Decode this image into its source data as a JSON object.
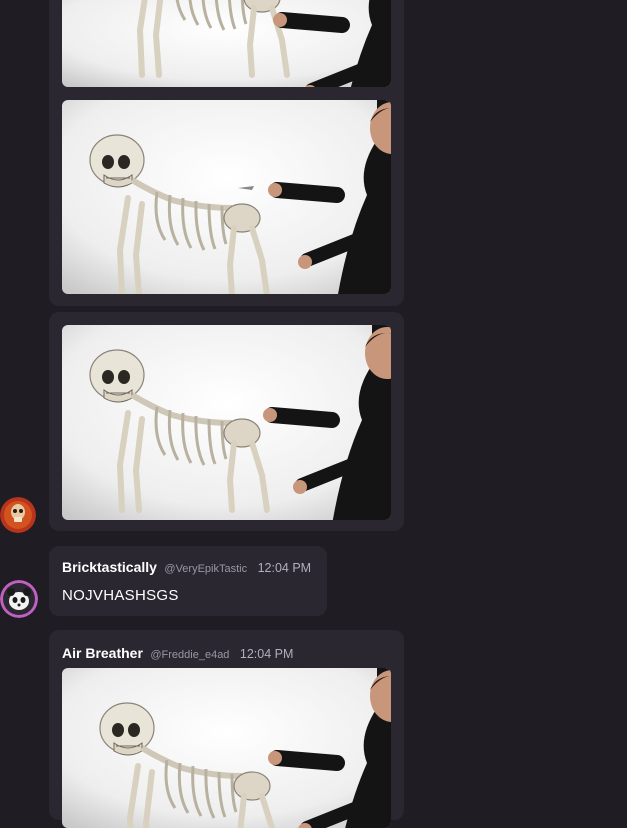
{
  "messages": [
    {
      "author": "Bricktastically",
      "handle": "@VeryEpikTastic",
      "time": "12:04 PM",
      "text": "NOJVHASHSGS"
    },
    {
      "author": "Air Breather",
      "handle": "@Freddie_e4ad",
      "time": "12:04 PM"
    }
  ],
  "avatars": {
    "first": "skull-avatar",
    "second": "panda-avatar"
  }
}
